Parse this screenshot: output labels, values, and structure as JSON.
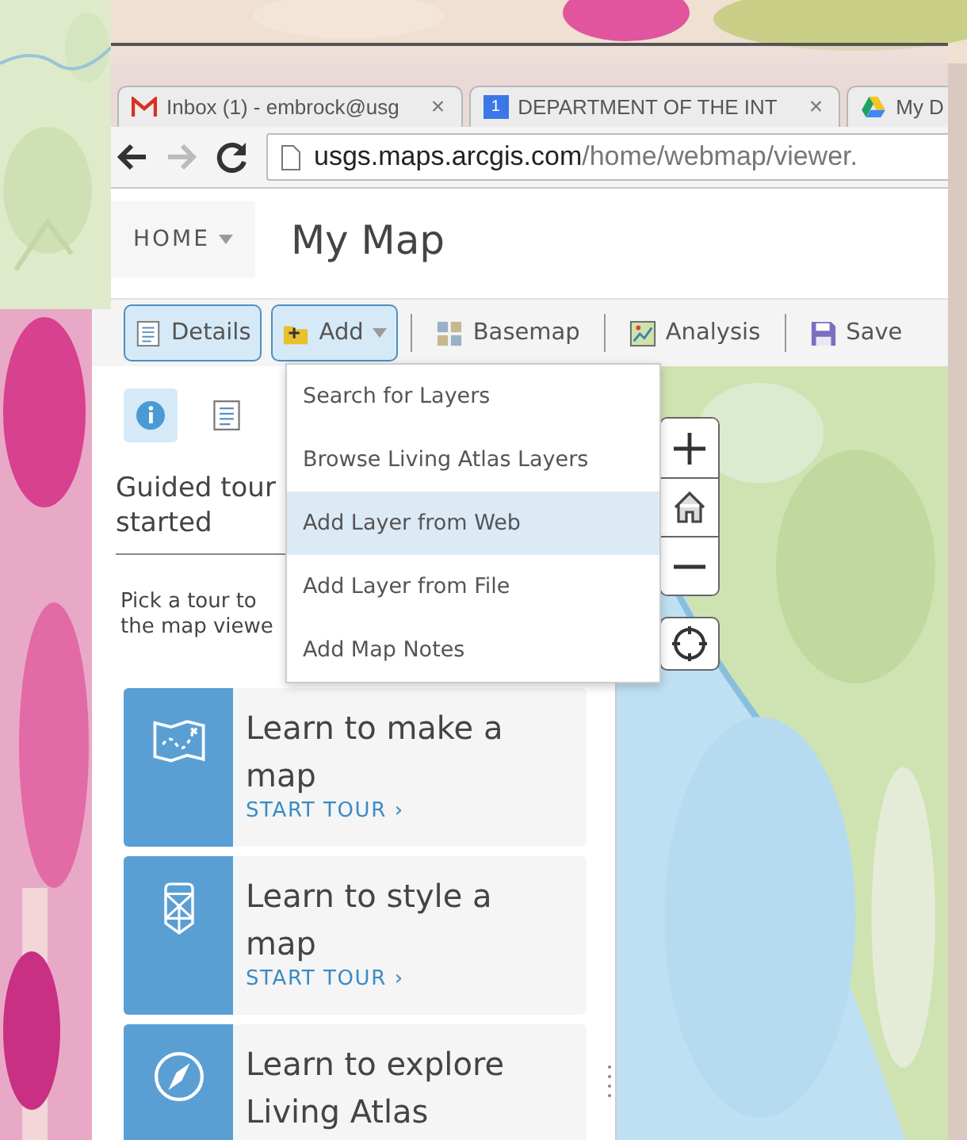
{
  "browser": {
    "tabs": [
      {
        "title": "Inbox (1) - embrock@usg",
        "close": "×"
      },
      {
        "icon_text": "1",
        "title": "DEPARTMENT OF THE INT",
        "close": "×"
      },
      {
        "title": "My D"
      }
    ],
    "nav": {
      "back_disabled": false,
      "forward_disabled": true
    },
    "address": {
      "host": "usgs.maps.arcgis.com",
      "path": "/home/webmap/viewer."
    }
  },
  "header": {
    "home": "HOME",
    "title": "My Map"
  },
  "toolbar": [
    {
      "kind": "details",
      "label": "Details",
      "selected": true,
      "caret": false
    },
    {
      "kind": "add",
      "label": "Add",
      "selected": true,
      "caret": true
    },
    {
      "kind": "basemap",
      "label": "Basemap",
      "selected": false,
      "caret": false
    },
    {
      "kind": "analysis",
      "label": "Analysis",
      "selected": false,
      "caret": false
    },
    {
      "kind": "save",
      "label": "Save",
      "selected": false,
      "caret": false
    }
  ],
  "add_menu": [
    {
      "label": "Search for Layers",
      "selected": false
    },
    {
      "label": "Browse Living Atlas Layers",
      "selected": false
    },
    {
      "label": "Add Layer from Web",
      "selected": true
    },
    {
      "label": "Add Layer from File",
      "selected": false
    },
    {
      "label": "Add Map Notes",
      "selected": false
    }
  ],
  "panel": {
    "tabs": [
      {
        "kind": "info",
        "selected": true
      },
      {
        "kind": "details",
        "selected": false
      }
    ],
    "heading": "Guided tour started",
    "description": "Pick a tour to the map viewe",
    "tours": [
      {
        "kind": "map",
        "title": "Learn to make a map",
        "action": "START TOUR ›"
      },
      {
        "kind": "style",
        "title": "Learn to style a map",
        "action": "START TOUR ›"
      },
      {
        "kind": "explore",
        "title": "Learn to explore Living Atlas"
      }
    ]
  }
}
